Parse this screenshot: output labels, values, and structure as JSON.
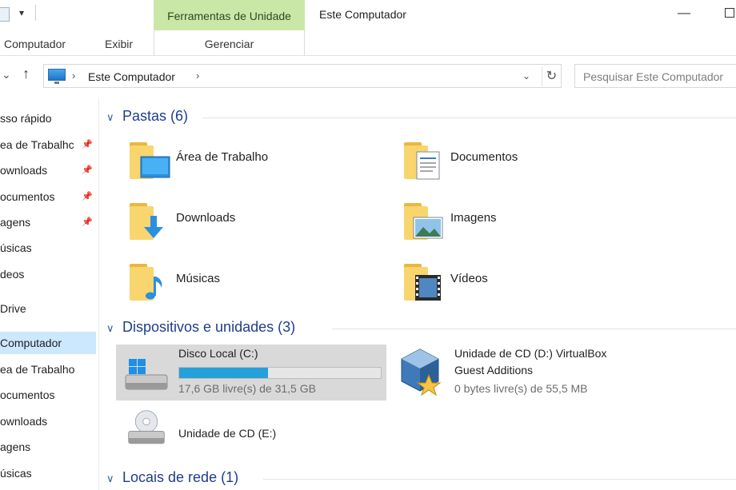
{
  "titlebar": {
    "tools_tab": "Ferramentas de Unidade",
    "window_title": "Este Computador"
  },
  "ribbon": {
    "tab_computador": "Computador",
    "tab_exibir": "Exibir",
    "tab_gerenciar": "Gerenciar"
  },
  "address": {
    "crumb": "Este Computador",
    "search_placeholder": "Pesquisar Este Computador"
  },
  "navigation": {
    "items": [
      {
        "label": "sso rápido",
        "pinned": false
      },
      {
        "label": "ea de Trabalhc",
        "pinned": true
      },
      {
        "label": "ownloads",
        "pinned": true
      },
      {
        "label": "ocumentos",
        "pinned": true
      },
      {
        "label": "agens",
        "pinned": true
      },
      {
        "label": "úsicas",
        "pinned": false
      },
      {
        "label": "deos",
        "pinned": false
      },
      {
        "label": "Drive",
        "pinned": false
      },
      {
        "label": "Computador",
        "pinned": false,
        "selected": true
      },
      {
        "label": "ea de Trabalho",
        "pinned": false
      },
      {
        "label": "ocumentos",
        "pinned": false
      },
      {
        "label": "ownloads",
        "pinned": false
      },
      {
        "label": "agens",
        "pinned": false
      },
      {
        "label": "úsicas",
        "pinned": false
      }
    ]
  },
  "groups": {
    "folders_header": "Pastas (6)",
    "devices_header": "Dispositivos e unidades (3)",
    "network_header": "Locais de rede (1)"
  },
  "folders": [
    {
      "label": "Área de Trabalho",
      "icon": "desktop-folder-icon"
    },
    {
      "label": "Documentos",
      "icon": "documents-folder-icon"
    },
    {
      "label": "Downloads",
      "icon": "downloads-folder-icon"
    },
    {
      "label": "Imagens",
      "icon": "pictures-folder-icon"
    },
    {
      "label": "Músicas",
      "icon": "music-folder-icon"
    },
    {
      "label": "Vídeos",
      "icon": "videos-folder-icon"
    }
  ],
  "drives": {
    "c": {
      "name": "Disco Local (C:)",
      "free": "17,6 GB livre(s) de 31,5 GB",
      "used_fraction": 0.44
    },
    "d": {
      "name_line1": "Unidade de CD (D:) VirtualBox",
      "name_line2": "Guest Additions",
      "free": "0 bytes livre(s) de 55,5 MB"
    },
    "e": {
      "name": "Unidade de CD (E:)"
    }
  },
  "colors": {
    "tools_tab_bg": "#c9e8a8",
    "selection": "#cce8ff",
    "drive_fill": "#26a0da",
    "group_header": "#1e3d8f"
  }
}
